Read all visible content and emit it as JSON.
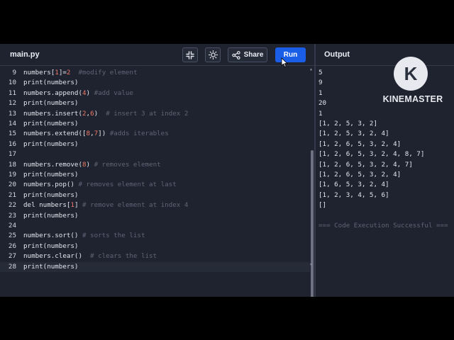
{
  "header": {
    "file_tab": "main.py",
    "share_label": "Share",
    "run_label": "Run",
    "output_title": "Output"
  },
  "icons": {
    "collapse": "collapse-icon",
    "theme": "sun-icon",
    "share": "share-icon",
    "cursor": "mouse-pointer-icon"
  },
  "colors": {
    "background": "#1f2330",
    "run_button": "#1a5ee8",
    "number": "#f07a66",
    "comment": "#5f6576"
  },
  "editor": {
    "lines": [
      {
        "n": "9",
        "tokens": [
          [
            "plain",
            "numbers["
          ],
          [
            "num",
            "1"
          ],
          [
            "plain",
            "]="
          ],
          [
            "num",
            "2"
          ],
          [
            "com",
            "  #modify element"
          ]
        ]
      },
      {
        "n": "10",
        "tokens": [
          [
            "plain",
            "print(numbers)"
          ]
        ]
      },
      {
        "n": "11",
        "tokens": [
          [
            "plain",
            "numbers.append("
          ],
          [
            "num",
            "4"
          ],
          [
            "plain",
            ") "
          ],
          [
            "com",
            "#add value"
          ]
        ]
      },
      {
        "n": "12",
        "tokens": [
          [
            "plain",
            "print(numbers)"
          ]
        ]
      },
      {
        "n": "13",
        "tokens": [
          [
            "plain",
            "numbers.insert("
          ],
          [
            "num",
            "2"
          ],
          [
            "plain",
            ","
          ],
          [
            "num",
            "6"
          ],
          [
            "plain",
            ")  "
          ],
          [
            "com",
            "# insert 3 at index 2"
          ]
        ]
      },
      {
        "n": "14",
        "tokens": [
          [
            "plain",
            "print(numbers)"
          ]
        ]
      },
      {
        "n": "15",
        "tokens": [
          [
            "plain",
            "numbers.extend(["
          ],
          [
            "num",
            "8"
          ],
          [
            "plain",
            ","
          ],
          [
            "num",
            "7"
          ],
          [
            "plain",
            "]) "
          ],
          [
            "com",
            "#adds iterables"
          ]
        ]
      },
      {
        "n": "16",
        "tokens": [
          [
            "plain",
            "print(numbers)"
          ]
        ]
      },
      {
        "n": "17",
        "tokens": []
      },
      {
        "n": "18",
        "tokens": [
          [
            "plain",
            "numbers.remove("
          ],
          [
            "num",
            "8"
          ],
          [
            "plain",
            ") "
          ],
          [
            "com",
            "# removes element"
          ]
        ]
      },
      {
        "n": "19",
        "tokens": [
          [
            "plain",
            "print(numbers)"
          ]
        ]
      },
      {
        "n": "20",
        "tokens": [
          [
            "plain",
            "numbers.pop() "
          ],
          [
            "com",
            "# removes element at last"
          ]
        ]
      },
      {
        "n": "21",
        "tokens": [
          [
            "plain",
            "print(numbers)"
          ]
        ]
      },
      {
        "n": "22",
        "tokens": [
          [
            "plain",
            "del numbers["
          ],
          [
            "num",
            "1"
          ],
          [
            "plain",
            "] "
          ],
          [
            "com",
            "# remove element at index 4"
          ]
        ]
      },
      {
        "n": "23",
        "tokens": [
          [
            "plain",
            "print(numbers)"
          ]
        ]
      },
      {
        "n": "24",
        "tokens": []
      },
      {
        "n": "25",
        "tokens": [
          [
            "plain",
            "numbers.sort() "
          ],
          [
            "com",
            "# sorts the list"
          ]
        ]
      },
      {
        "n": "26",
        "tokens": [
          [
            "plain",
            "print(numbers)"
          ]
        ]
      },
      {
        "n": "27",
        "tokens": [
          [
            "plain",
            "numbers.clear()  "
          ],
          [
            "com",
            "# clears the list"
          ]
        ]
      },
      {
        "n": "28",
        "tokens": [
          [
            "plain",
            "print(numbers)"
          ]
        ],
        "active": true
      }
    ]
  },
  "output": {
    "lines": [
      "5",
      "9",
      "1",
      "20",
      "1",
      "[1, 2, 5, 3, 2]",
      "[1, 2, 5, 3, 2, 4]",
      "[1, 2, 6, 5, 3, 2, 4]",
      "[1, 2, 6, 5, 3, 2, 4, 8, 7]",
      "[1, 2, 6, 5, 3, 2, 4, 7]",
      "[1, 2, 6, 5, 3, 2, 4]",
      "[1, 6, 5, 3, 2, 4]",
      "[1, 2, 3, 4, 5, 6]",
      "[]",
      "",
      "=== Code Execution Successful ==="
    ]
  },
  "watermark": {
    "letter": "K",
    "text": "KINEMASTER"
  }
}
